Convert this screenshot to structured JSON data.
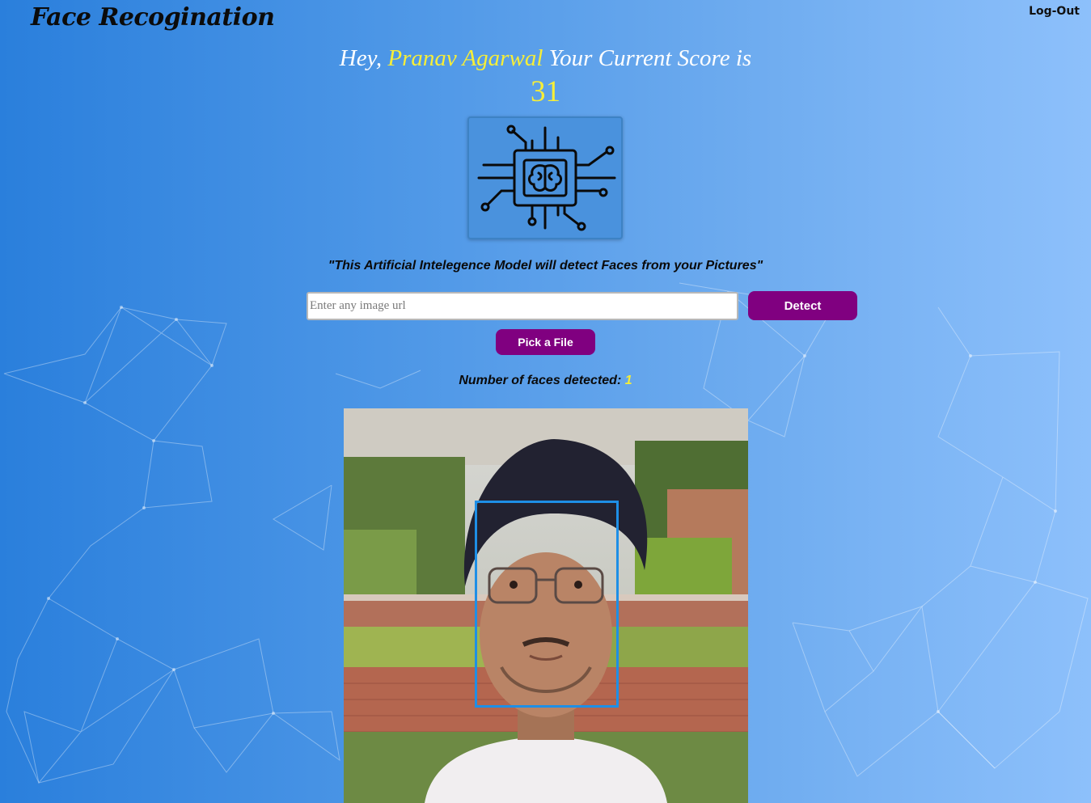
{
  "app": {
    "brand": "Face Recogination",
    "logout_label": "Log-Out"
  },
  "greeting": {
    "prefix": "Hey, ",
    "user_name": "Pranav Agarwal",
    "suffix": " Your Current Score is",
    "score": "31"
  },
  "logo": {
    "icon": "ai-brain-chip-icon"
  },
  "tagline": "\"This Artificial Intelegence Model will detect Faces from your Pictures\"",
  "search": {
    "placeholder": "Enter any image url",
    "value": ""
  },
  "buttons": {
    "detect_label": "Detect",
    "pick_file_label": "Pick a File"
  },
  "result": {
    "label": "Number of faces detected: ",
    "count": "1"
  },
  "colors": {
    "accent_button": "#800080",
    "highlight_text": "#f6ee38",
    "face_box": "#1e8fe6"
  }
}
